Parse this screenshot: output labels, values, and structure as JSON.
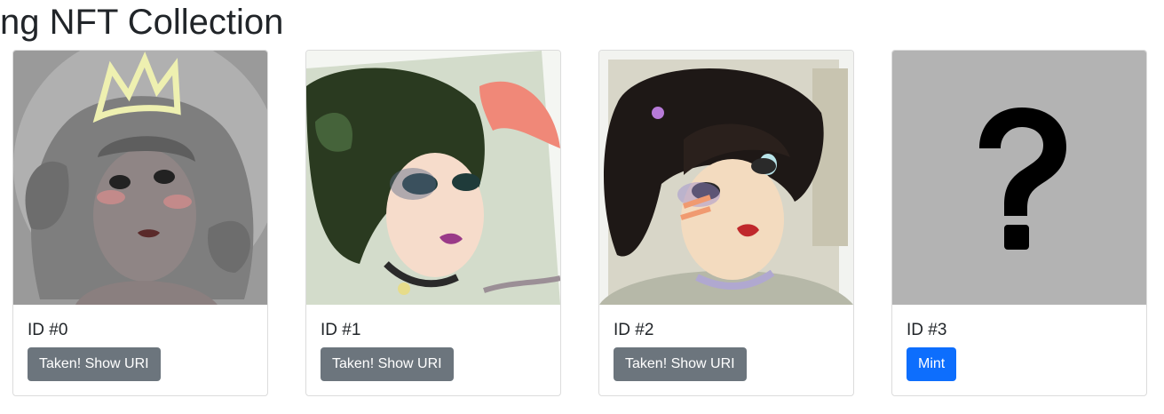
{
  "page_title": "ining NFT Collection",
  "cards": [
    {
      "id_label": "ID #0",
      "button_label": "Taken! Show URI",
      "image_icon": "portrait-crowned-grey"
    },
    {
      "id_label": "ID #1",
      "button_label": "Taken! Show URI",
      "image_icon": "portrait-green-hair"
    },
    {
      "id_label": "ID #2",
      "button_label": "Taken! Show URI",
      "image_icon": "portrait-dark-hair"
    },
    {
      "id_label": "ID #3",
      "button_label": "Mint",
      "image_icon": "question-mark-placeholder"
    }
  ],
  "colors": {
    "taken_button": "#6c757d",
    "mint_button": "#0d6efd",
    "placeholder_bg": "#b3b3b3"
  }
}
